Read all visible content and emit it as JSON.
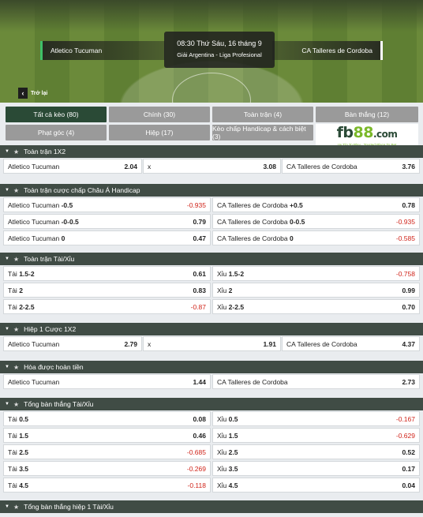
{
  "match": {
    "home": "Atletico Tucuman",
    "away": "CA Talleres de Cordoba",
    "time": "08:30 Thứ Sáu, 16 tháng 9",
    "league": "Giải Argentina - Liga Profesional",
    "back_label": "Trở lại"
  },
  "tabs": [
    {
      "label": "Tất cả kèo (80)",
      "active": true
    },
    {
      "label": "Chính (30)",
      "active": false
    },
    {
      "label": "Toàn trận (4)",
      "active": false
    },
    {
      "label": "Bàn thắng (12)",
      "active": false
    },
    {
      "label": "Phạt góc (4)",
      "active": false
    },
    {
      "label": "Hiệp (17)",
      "active": false
    },
    {
      "label": "Kèo chấp Handicap & cách biệt (3)",
      "active": false
    }
  ],
  "ad": {
    "logo_fb": "fb",
    "logo_88": "88",
    "logo_dot": ".com",
    "tagline": "Uy Tín To Play · Trusted Place To Bet"
  },
  "sections": [
    {
      "title": "Toàn trận 1X2",
      "layout": 3,
      "rows": [
        [
          {
            "label": "Atletico Tucuman",
            "odd": "2.04"
          },
          {
            "label": "x",
            "odd": "3.08"
          },
          {
            "label": "CA Talleres de Cordoba",
            "odd": "3.76"
          }
        ]
      ]
    },
    {
      "title": "Toàn trận cược chấp Châu Á Handicap",
      "layout": 2,
      "rows": [
        [
          {
            "label": "Atletico Tucuman",
            "line": "-0.5",
            "odd": "-0.935"
          },
          {
            "label": "CA Talleres de Cordoba",
            "line": "+0.5",
            "odd": "0.78"
          }
        ],
        [
          {
            "label": "Atletico Tucuman",
            "line": "-0-0.5",
            "odd": "0.79"
          },
          {
            "label": "CA Talleres de Cordoba",
            "line": "0-0.5",
            "odd": "-0.935"
          }
        ],
        [
          {
            "label": "Atletico Tucuman",
            "line": "0",
            "odd": "0.47"
          },
          {
            "label": "CA Talleres de Cordoba",
            "line": "0",
            "odd": "-0.585"
          }
        ]
      ]
    },
    {
      "title": "Toàn trận Tài/Xỉu",
      "layout": 2,
      "rows": [
        [
          {
            "label": "Tài",
            "line": "1.5-2",
            "odd": "0.61"
          },
          {
            "label": "Xỉu",
            "line": "1.5-2",
            "odd": "-0.758"
          }
        ],
        [
          {
            "label": "Tài",
            "line": "2",
            "odd": "0.83"
          },
          {
            "label": "Xỉu",
            "line": "2",
            "odd": "0.99"
          }
        ],
        [
          {
            "label": "Tài",
            "line": "2-2.5",
            "odd": "-0.87"
          },
          {
            "label": "Xỉu",
            "line": "2-2.5",
            "odd": "0.70"
          }
        ]
      ]
    },
    {
      "title": "Hiệp 1 Cược 1X2",
      "layout": 3,
      "rows": [
        [
          {
            "label": "Atletico Tucuman",
            "odd": "2.79"
          },
          {
            "label": "x",
            "odd": "1.91"
          },
          {
            "label": "CA Talleres de Cordoba",
            "odd": "4.37"
          }
        ]
      ]
    },
    {
      "title": "Hòa được hoàn tiền",
      "layout": 2,
      "rows": [
        [
          {
            "label": "Atletico Tucuman",
            "odd": "1.44"
          },
          {
            "label": "CA Talleres de Cordoba",
            "odd": "2.73"
          }
        ]
      ]
    },
    {
      "title": "Tổng bàn thắng Tài/Xỉu",
      "layout": 2,
      "rows": [
        [
          {
            "label": "Tài",
            "line": "0.5",
            "odd": "0.08"
          },
          {
            "label": "Xỉu",
            "line": "0.5",
            "odd": "-0.167"
          }
        ],
        [
          {
            "label": "Tài",
            "line": "1.5",
            "odd": "0.46"
          },
          {
            "label": "Xỉu",
            "line": "1.5",
            "odd": "-0.629"
          }
        ],
        [
          {
            "label": "Tài",
            "line": "2.5",
            "odd": "-0.685"
          },
          {
            "label": "Xỉu",
            "line": "2.5",
            "odd": "0.52"
          }
        ],
        [
          {
            "label": "Tài",
            "line": "3.5",
            "odd": "-0.269"
          },
          {
            "label": "Xỉu",
            "line": "3.5",
            "odd": "0.17"
          }
        ],
        [
          {
            "label": "Tài",
            "line": "4.5",
            "odd": "-0.118"
          },
          {
            "label": "Xỉu",
            "line": "4.5",
            "odd": "0.04"
          }
        ]
      ]
    },
    {
      "title": "Tổng bàn thắng hiệp 1 Tài/Xỉu",
      "layout": 2,
      "rows": []
    }
  ],
  "colors": {
    "header": "#404c45",
    "active_tab": "#2a4a36",
    "tab": "#9a9a9a",
    "negative_odd": "#d0241a",
    "brand_green": "#7ab829"
  }
}
